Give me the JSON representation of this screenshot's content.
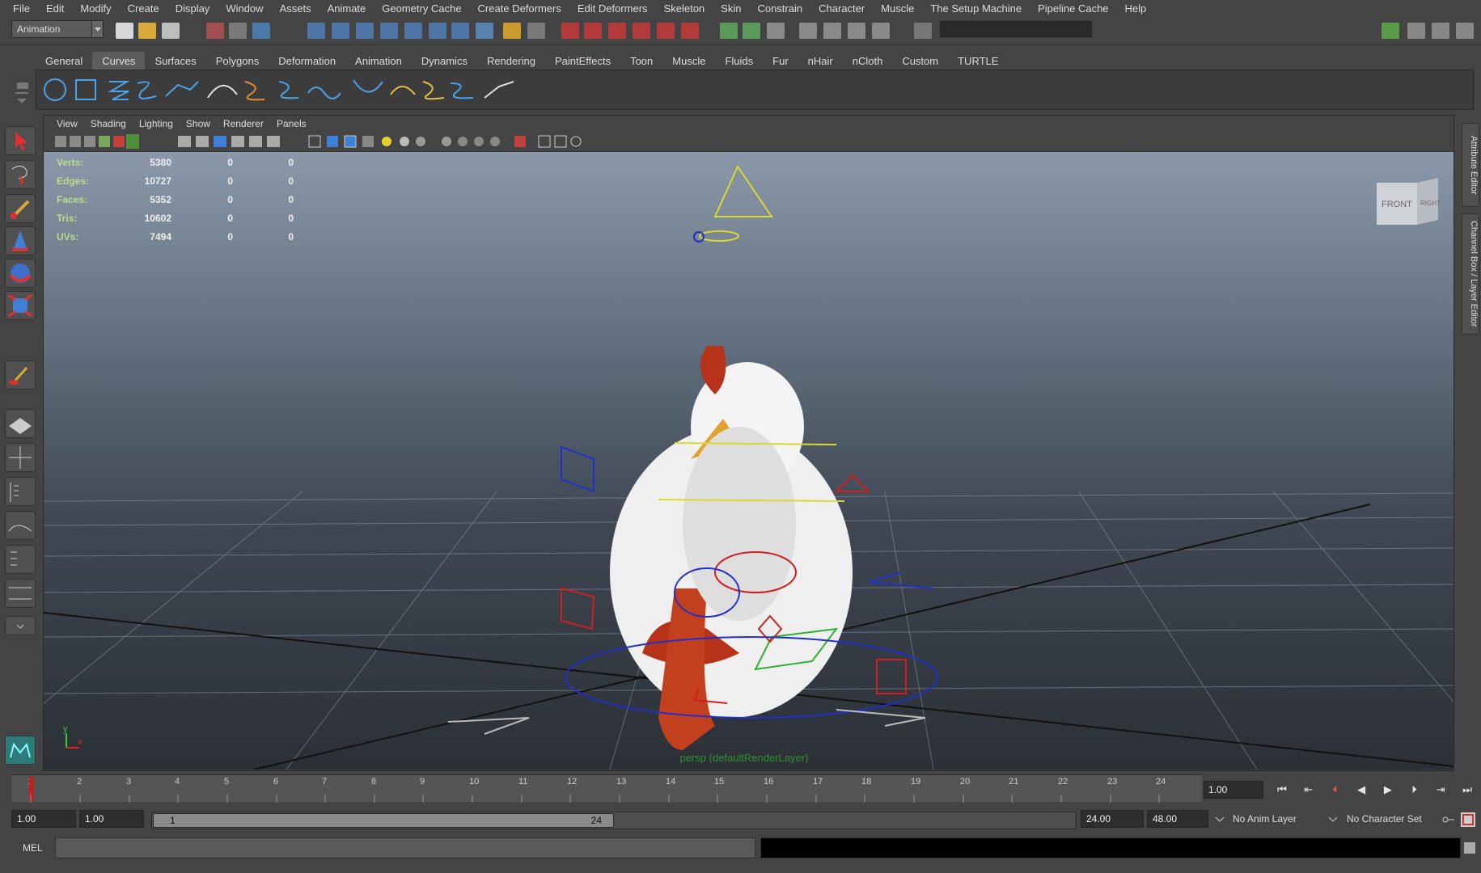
{
  "menubar": {
    "items": [
      "File",
      "Edit",
      "Modify",
      "Create",
      "Display",
      "Window",
      "Assets",
      "Animate",
      "Geometry Cache",
      "Create Deformers",
      "Edit Deformers",
      "Skeleton",
      "Skin",
      "Constrain",
      "Character",
      "Muscle",
      "The Setup Machine",
      "Pipeline Cache",
      "Help"
    ]
  },
  "statusline": {
    "mode": "Animation"
  },
  "shelf": {
    "tabs": [
      "General",
      "Curves",
      "Surfaces",
      "Polygons",
      "Deformation",
      "Animation",
      "Dynamics",
      "Rendering",
      "PaintEffects",
      "Toon",
      "Muscle",
      "Fluids",
      "Fur",
      "nHair",
      "nCloth",
      "Custom",
      "TURTLE"
    ],
    "active_tab": "Curves"
  },
  "panel": {
    "menus": [
      "View",
      "Shading",
      "Lighting",
      "Show",
      "Renderer",
      "Panels"
    ],
    "camera_label": "persp (defaultRenderLayer)"
  },
  "hud": {
    "rows": [
      {
        "label": "Verts:",
        "a": "5380",
        "b": "0",
        "c": "0"
      },
      {
        "label": "Edges:",
        "a": "10727",
        "b": "0",
        "c": "0"
      },
      {
        "label": "Faces:",
        "a": "5352",
        "b": "0",
        "c": "0"
      },
      {
        "label": "Tris:",
        "a": "10602",
        "b": "0",
        "c": "0"
      },
      {
        "label": "UVs:",
        "a": "7494",
        "b": "0",
        "c": "0"
      }
    ]
  },
  "viewcube": {
    "front": "FRONT",
    "right": "RIGHT"
  },
  "axis": {
    "y": "y",
    "x": "x"
  },
  "rightdock": {
    "attribute_editor": "Attribute Editor",
    "channel_box": "Channel Box / Layer Editor"
  },
  "timeslider": {
    "ticks": [
      "1",
      "2",
      "3",
      "4",
      "5",
      "6",
      "7",
      "8",
      "9",
      "10",
      "11",
      "12",
      "13",
      "14",
      "15",
      "16",
      "17",
      "18",
      "19",
      "20",
      "21",
      "22",
      "23",
      "24"
    ],
    "current_frame": "1.00"
  },
  "range": {
    "start": "1.00",
    "playback_start": "1.00",
    "slider_start": "1",
    "slider_end": "24",
    "playback_end": "24.00",
    "end": "48.00",
    "anim_layer": "No Anim Layer",
    "character_set": "No Character Set"
  },
  "cmdline": {
    "label": "MEL"
  },
  "colors": {
    "ui_bg": "#444444",
    "viewport_top": "#8a98a9",
    "viewport_bottom": "#2c3036",
    "hud_label": "#b9dd88",
    "camera_label": "#2f8f2f"
  }
}
